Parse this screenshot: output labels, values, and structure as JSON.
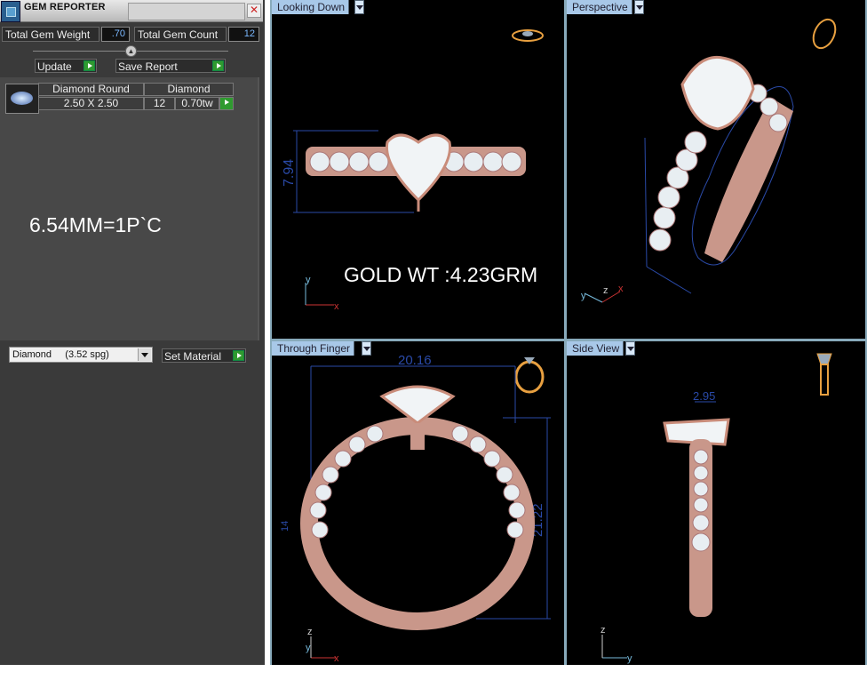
{
  "window": {
    "title": "GEM REPORTER",
    "close_glyph": "✕"
  },
  "totals": {
    "weight_label": "Total Gem Weight",
    "weight_value": ".70",
    "count_label": "Total Gem Count",
    "count_value": "12"
  },
  "toolbar": {
    "update_label": "Update",
    "save_report_label": "Save Report"
  },
  "gem_row": {
    "icon": "diamond-round-icon",
    "shape_header": "Diamond Round",
    "type_header": "Diamond",
    "size": "2.50 X 2.50",
    "count": "12",
    "weight": "0.70tw"
  },
  "note": "6.54MM=1P`C",
  "material": {
    "selected": "Diamond     (3.52 spg)",
    "set_label": "Set Material"
  },
  "viewports": {
    "top": {
      "label": "Looking Down",
      "dimension": "7.94"
    },
    "perspective": {
      "label": "Perspective"
    },
    "front": {
      "label": "Through Finger",
      "dimension_width": "20.16",
      "dimension_height": "21.22",
      "dimension_small": "14"
    },
    "side": {
      "label": "Side View",
      "dimension": "2.95"
    }
  },
  "gold_weight": "GOLD WT :4.23GRM",
  "axes": {
    "x": "x",
    "y": "y",
    "z": "z"
  },
  "colors": {
    "panel_bg": "#3a3a3a",
    "value_text": "#7ab8ff",
    "go_button": "#2f9a2f",
    "viewport_tab": "#a8c8e8",
    "dimension_lines": "#2a4aa8",
    "metal": "#c98c7a"
  }
}
